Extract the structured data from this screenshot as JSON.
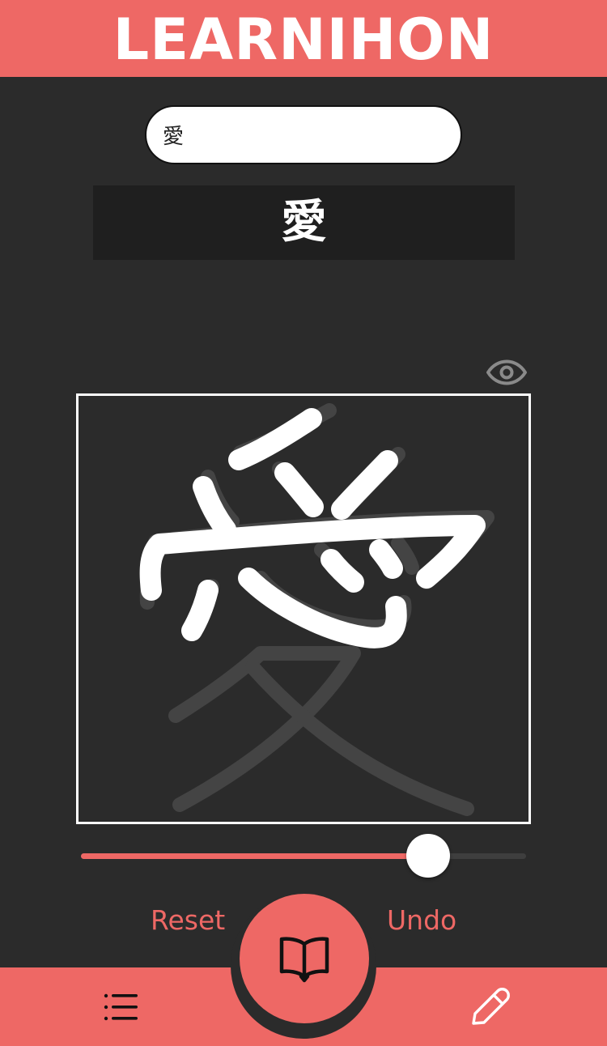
{
  "header": {
    "title": "LEARNIHON"
  },
  "search": {
    "value": "愛",
    "placeholder": ""
  },
  "kanji_display": {
    "character": "愛"
  },
  "canvas": {
    "guide_character": "愛",
    "guide_visible": true
  },
  "slider": {
    "value_fraction": 0.78
  },
  "actions": {
    "reset_label": "Reset",
    "undo_label": "Undo"
  },
  "tabbar": {
    "left_icon": "list-icon",
    "center_icon": "book-open-icon",
    "right_icon": "pencil-icon"
  },
  "colors": {
    "accent": "#ee6865",
    "background": "#2b2b2b",
    "panel": "#1f1f1f",
    "stroke": "#ffffff"
  }
}
